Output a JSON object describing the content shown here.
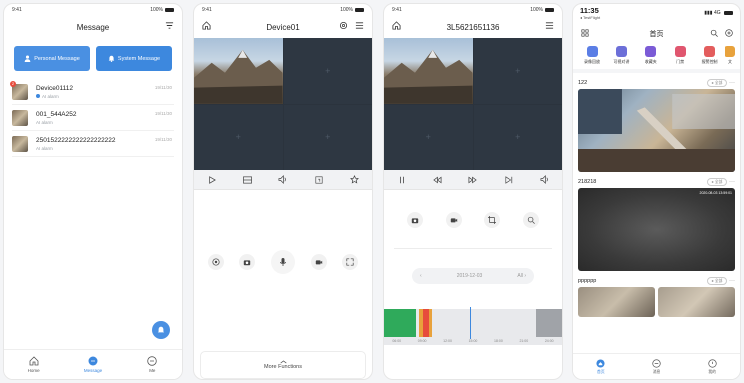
{
  "screen1": {
    "status_time": "9:41",
    "status_battery": "100%",
    "title": "Message",
    "buttons": {
      "personal": "Personal Message",
      "system": "System Message"
    },
    "messages": [
      {
        "name": "Device01112",
        "sub": "AI alarm",
        "date": "19/11/30",
        "badge": "2"
      },
      {
        "name": "001_544A252",
        "sub": "AI alarm",
        "date": "19/11/30"
      },
      {
        "name": "2501522222222222222222",
        "sub": "AI alarm",
        "date": "19/11/30"
      }
    ],
    "tabs": [
      {
        "label": "Home"
      },
      {
        "label": "Message"
      },
      {
        "label": "Me"
      }
    ]
  },
  "screen2": {
    "status_time": "9:41",
    "status_battery": "100%",
    "title": "Device01",
    "more_label": "More Functions"
  },
  "screen3": {
    "status_time": "9:41",
    "status_battery": "100%",
    "title": "3L5621651136",
    "date": "2019-12-03",
    "all": "All",
    "time_labels": [
      "06:00",
      "09:00",
      "12:00",
      "15:00",
      "18:00",
      "21:00",
      "24:00"
    ]
  },
  "screen4": {
    "status_time": "11:35",
    "status_sub": "◂ TestFlight",
    "status_signal": "4G",
    "title": "首页",
    "categories": [
      {
        "label": "录像回放",
        "color": "#5b7ee5"
      },
      {
        "label": "可视对讲",
        "color": "#6c6fd8"
      },
      {
        "label": "收藏夹",
        "color": "#7b5bd6"
      },
      {
        "label": "门禁",
        "color": "#e0566f"
      },
      {
        "label": "报警控制",
        "color": "#e35d5d"
      },
      {
        "label": "文",
        "color": "#e8a23c"
      }
    ],
    "cameras": [
      {
        "name": "122",
        "all": "全部"
      },
      {
        "name": "218218",
        "all": "全部",
        "overlay": "2020-08-03 13:59:01"
      },
      {
        "name": "pppppp",
        "all": "全部"
      }
    ],
    "tabs": [
      {
        "label": "首页"
      },
      {
        "label": "消息"
      },
      {
        "label": "我的"
      }
    ]
  }
}
